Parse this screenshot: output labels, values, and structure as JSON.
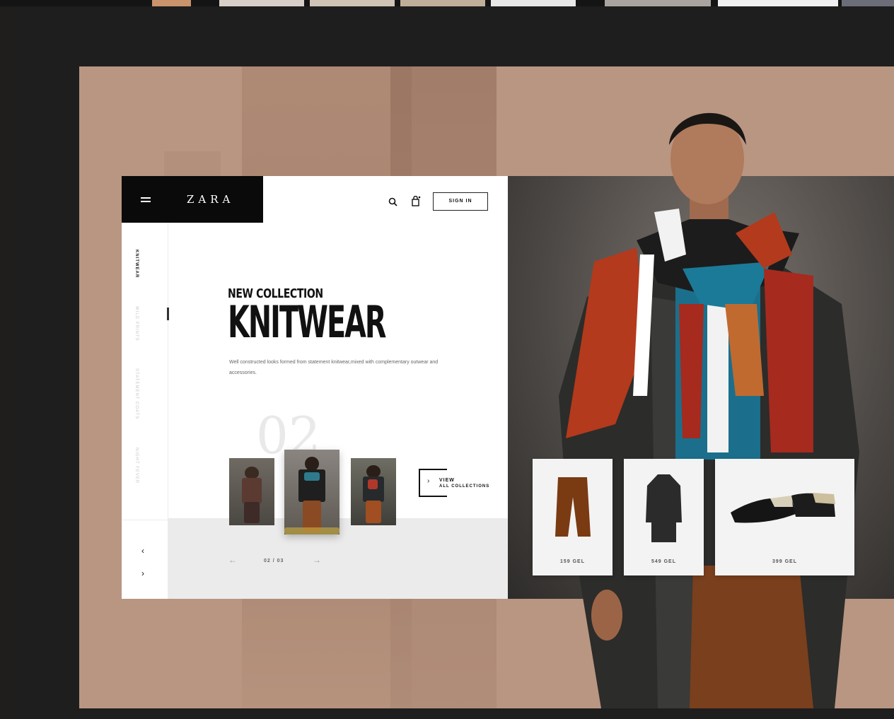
{
  "brand": {
    "logo": "ZARA"
  },
  "header": {
    "sign_in_label": "SIGN IN"
  },
  "sidebar": {
    "items": [
      {
        "label": "KNITWEAR"
      },
      {
        "label": "WILD PRINTS"
      },
      {
        "label": "STATEMENT COATS"
      },
      {
        "label": "NIGHT FEVER"
      }
    ]
  },
  "hero": {
    "subtitle": "NEW COLLECTION",
    "title": "KNITWEAR",
    "description": "Well constructed looks formed from statement knitwear,mixed with complementary outwear and accessories.",
    "slide_number": "02"
  },
  "view_all": {
    "line1": "VIEW",
    "line2": "ALL COLLECTIONS"
  },
  "pager": {
    "label": "02 / 03"
  },
  "products": [
    {
      "name": "trousers",
      "price": "159 GEL"
    },
    {
      "name": "coat",
      "price": "549 GEL"
    },
    {
      "name": "shoes",
      "price": "399 GEL"
    }
  ],
  "icons": [
    "menu-icon",
    "search-icon",
    "bag-icon",
    "chevron-left-icon",
    "chevron-right-icon",
    "arrow-left-icon",
    "arrow-right-icon",
    "chevron-right-icon"
  ],
  "colors": {
    "backdrop": "#b99682",
    "frame": "#1e1e1e",
    "logo_box": "#0a0a0a",
    "card": "#ffffff"
  }
}
